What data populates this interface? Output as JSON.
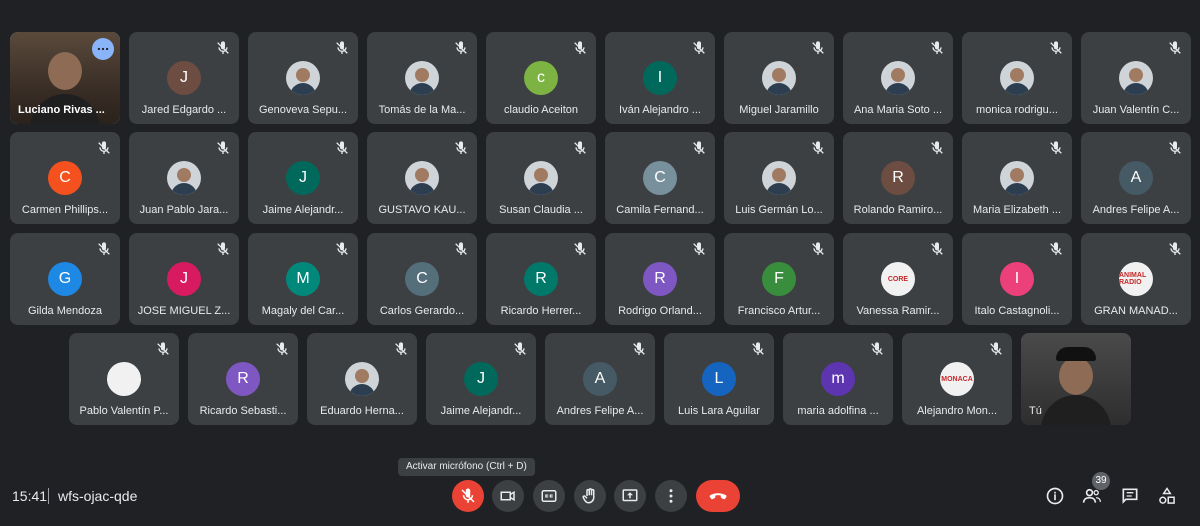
{
  "participants": [
    {
      "name": "Luciano Rivas ...",
      "kind": "video-host"
    },
    {
      "name": "Jared Edgardo ...",
      "initial": "J",
      "color": "#6d4c41"
    },
    {
      "name": "Genoveva Sepu...",
      "kind": "photo"
    },
    {
      "name": "Tomás de la Ma...",
      "kind": "photo"
    },
    {
      "name": "claudio Aceiton",
      "initial": "c",
      "color": "#7cb342"
    },
    {
      "name": "Iván Alejandro ...",
      "initial": "I",
      "color": "#00695c"
    },
    {
      "name": "Miguel Jaramillo",
      "kind": "photo"
    },
    {
      "name": "Ana Maria Soto ...",
      "kind": "photo"
    },
    {
      "name": "monica rodrigu...",
      "kind": "photo"
    },
    {
      "name": "Juan Valentín C...",
      "kind": "photo"
    },
    {
      "name": "Carmen Phillips...",
      "initial": "C",
      "color": "#f4511e"
    },
    {
      "name": "Juan Pablo Jara...",
      "kind": "photo"
    },
    {
      "name": "Jaime Alejandr...",
      "initial": "J",
      "color": "#00695c"
    },
    {
      "name": "GUSTAVO KAU...",
      "kind": "photo"
    },
    {
      "name": "Susan Claudia ...",
      "kind": "photo"
    },
    {
      "name": "Camila Fernand...",
      "initial": "C",
      "color": "#78909c"
    },
    {
      "name": "Luis Germán Lo...",
      "kind": "photo"
    },
    {
      "name": "Rolando Ramiro...",
      "initial": "R",
      "color": "#6d4c41"
    },
    {
      "name": "Maria Elizabeth ...",
      "kind": "photo"
    },
    {
      "name": "Andres Felipe A...",
      "initial": "A",
      "color": "#455a64"
    },
    {
      "name": "Gilda Mendoza",
      "initial": "G",
      "color": "#1e88e5"
    },
    {
      "name": "JOSE MIGUEL Z...",
      "initial": "J",
      "color": "#d81b60"
    },
    {
      "name": "Magaly del Car...",
      "initial": "M",
      "color": "#00897b"
    },
    {
      "name": "Carlos Gerardo...",
      "initial": "C",
      "color": "#546e7a"
    },
    {
      "name": "Ricardo Herrer...",
      "initial": "R",
      "color": "#00796b"
    },
    {
      "name": "Rodrigo Orland...",
      "initial": "R",
      "color": "#7e57c2"
    },
    {
      "name": "Francisco Artur...",
      "initial": "F",
      "color": "#388e3c"
    },
    {
      "name": "Vanessa Ramir...",
      "kind": "logo",
      "logo_text": "CORE"
    },
    {
      "name": "Italo Castagnoli...",
      "initial": "I",
      "color": "#ec407a"
    },
    {
      "name": "GRAN MANAD...",
      "kind": "logo",
      "logo_text": "ANIMAL RADIO"
    },
    {
      "name": "Pablo Valentín P...",
      "kind": "logo",
      "logo_text": ""
    },
    {
      "name": "Ricardo Sebasti...",
      "initial": "R",
      "color": "#7e57c2"
    },
    {
      "name": "Eduardo Herna...",
      "kind": "photo"
    },
    {
      "name": "Jaime Alejandr...",
      "initial": "J",
      "color": "#00695c"
    },
    {
      "name": "Andres Felipe A...",
      "initial": "A",
      "color": "#455a64"
    },
    {
      "name": "Luis Lara Aguilar",
      "initial": "L",
      "color": "#1565c0"
    },
    {
      "name": "maria adolfina ...",
      "initial": "m",
      "color": "#5e35b1"
    },
    {
      "name": "Alejandro Mon...",
      "kind": "logo",
      "logo_text": "MONACA"
    },
    {
      "name": "Tú",
      "kind": "video-self"
    }
  ],
  "tooltip": "Activar micrófono (Ctrl + D)",
  "bottom": {
    "time": "15:41",
    "meeting_code": "wfs-ojac-qde",
    "participant_count": "39"
  },
  "colors": {
    "accent": "#8ab4f8",
    "danger": "#ea4335",
    "tile": "#3c4043",
    "bg": "#202124"
  }
}
